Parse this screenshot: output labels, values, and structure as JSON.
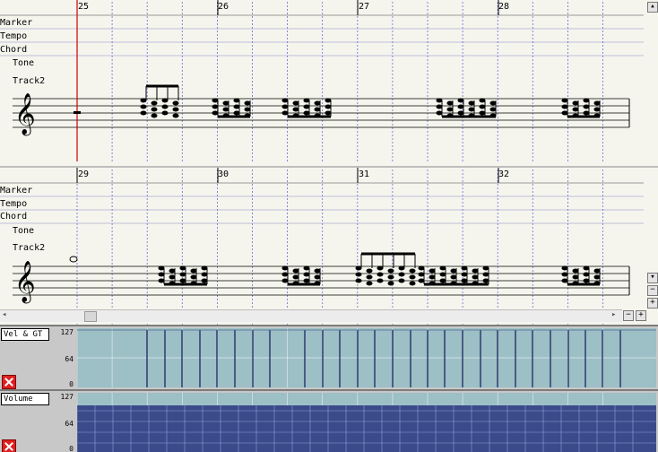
{
  "track_rows": [
    "Marker",
    "Tempo",
    "Chord"
  ],
  "tone_label": "Tone",
  "track_name": "Track2",
  "systems": [
    {
      "measures": [
        "25",
        "26",
        "27",
        "28"
      ]
    },
    {
      "measures": [
        "29",
        "30",
        "31",
        "32"
      ]
    }
  ],
  "controllers": [
    {
      "name": "Vel & GT",
      "scale": [
        "127",
        "64",
        "0"
      ]
    },
    {
      "name": "Volume",
      "scale": [
        "127",
        "64",
        "0"
      ]
    }
  ],
  "scroll": {
    "left_arrow": "◂",
    "right_arrow": "▸",
    "up_arrow": "▴",
    "down_arrow": "▾",
    "zoom_out": "−",
    "zoom_in": "+"
  },
  "colors": {
    "playhead": "#d00000",
    "grid": "#6a6ad8",
    "control_bg": "#9dbfc6",
    "bar": "#2b3a6e"
  }
}
